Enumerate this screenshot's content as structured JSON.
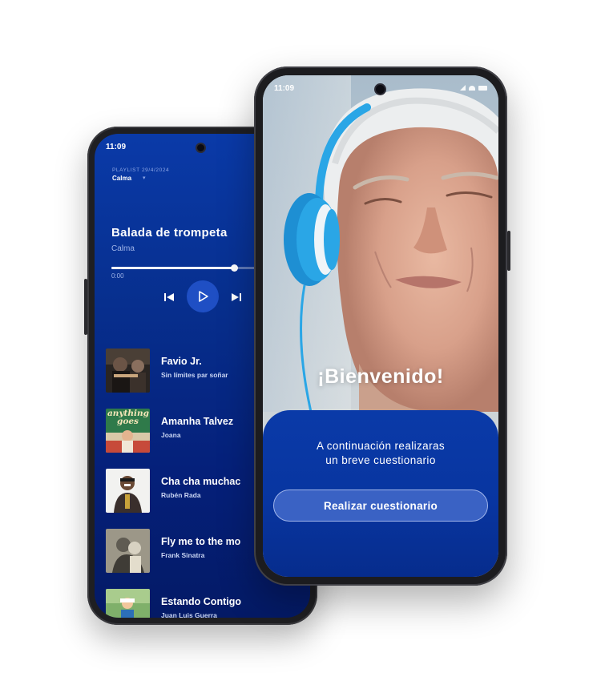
{
  "player_screen": {
    "status_time": "11:09",
    "playlist_label": "PLAYLIST 29/4/2024",
    "playlist_name": "Calma",
    "now_playing": {
      "title": "Balada de trompeta",
      "artist": "Calma",
      "elapsed": "0:00",
      "progress": 0.85
    },
    "controls": [
      "skip-previous-icon",
      "play-icon",
      "skip-next-icon"
    ],
    "tracks": [
      {
        "title": "Favio Jr.",
        "artist": "Sin límites par soñar"
      },
      {
        "title": "Amanha Talvez",
        "artist": "Joana",
        "art_text": "anything goes"
      },
      {
        "title": "Cha cha muchac",
        "artist": "Rubén Rada"
      },
      {
        "title": "Fly me to the mo",
        "artist": "Frank Sinatra"
      },
      {
        "title": "Estando Contigo",
        "artist": "Juan Luis Guerra"
      }
    ]
  },
  "welcome_screen": {
    "status_time": "11:09",
    "title": "¡Bienvenido!",
    "message_line1": "A continuación realizaras",
    "message_line2": "un breve cuestionario",
    "button_label": "Realizar cuestionario"
  },
  "colors": {
    "primary_blue": "#0a3aa8",
    "button_blue": "#3a62c4",
    "headphone_cyan": "#2aa6e6"
  }
}
